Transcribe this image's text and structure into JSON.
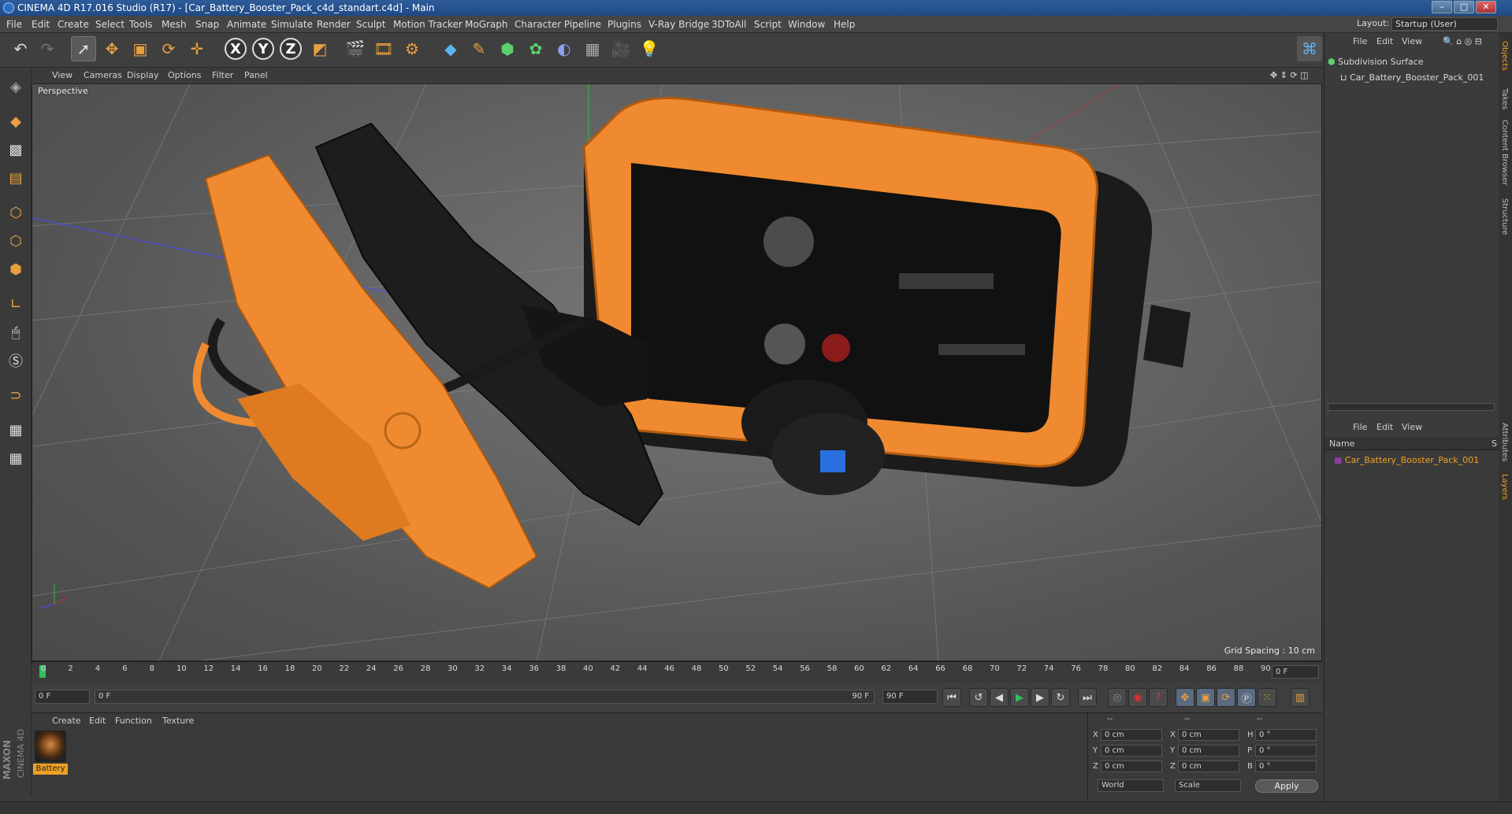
{
  "window": {
    "title": "CINEMA 4D R17.016 Studio (R17) - [Car_Battery_Booster_Pack_c4d_standart.c4d] - Main",
    "layout_label": "Layout:",
    "layout_value": "Startup (User)"
  },
  "menubar": {
    "items": [
      "File",
      "Edit",
      "Create",
      "Select",
      "Tools",
      "Mesh",
      "Snap",
      "Animate",
      "Simulate",
      "Render",
      "Sculpt",
      "Motion Tracker",
      "MoGraph",
      "Character",
      "Pipeline",
      "Plugins",
      "V-Ray Bridge",
      "3DToAll",
      "Script",
      "Window",
      "Help"
    ]
  },
  "toolbar": {
    "axis_x": "X",
    "axis_y": "Y",
    "axis_z": "Z"
  },
  "viewport": {
    "menu": [
      "View",
      "Cameras",
      "Display",
      "Options",
      "Filter",
      "Panel"
    ],
    "camera_label": "Perspective",
    "grid_spacing": "Grid Spacing : 10 cm"
  },
  "timeline": {
    "ticks": [
      "0",
      "2",
      "4",
      "6",
      "8",
      "10",
      "12",
      "14",
      "16",
      "18",
      "20",
      "22",
      "24",
      "26",
      "28",
      "30",
      "32",
      "34",
      "36",
      "38",
      "40",
      "42",
      "44",
      "46",
      "48",
      "50",
      "52",
      "54",
      "56",
      "58",
      "60",
      "62",
      "64",
      "66",
      "68",
      "70",
      "72",
      "74",
      "76",
      "78",
      "80",
      "82",
      "84",
      "86",
      "88",
      "90"
    ],
    "current_frame": "0 F"
  },
  "transport": {
    "start_field": "0 F",
    "range_start": "0 F",
    "range_end": "90 F",
    "end_field": "90 F"
  },
  "material_manager": {
    "menu": [
      "Create",
      "Edit",
      "Function",
      "Texture"
    ],
    "material_name": "Battery"
  },
  "branding": {
    "vendor": "MAXON",
    "product": "CINEMA 4D"
  },
  "coordinates": {
    "header": [
      "--",
      "--",
      "--"
    ],
    "rows": [
      {
        "a": "X",
        "av": "0 cm",
        "b": "X",
        "bv": "0 cm",
        "c": "H",
        "cv": "0 °"
      },
      {
        "a": "Y",
        "av": "0 cm",
        "b": "Y",
        "bv": "0 cm",
        "c": "P",
        "cv": "0 °"
      },
      {
        "a": "Z",
        "av": "0 cm",
        "b": "Z",
        "bv": "0 cm",
        "c": "B",
        "cv": "0 °"
      }
    ],
    "space": "World",
    "mode": "Scale",
    "apply": "Apply"
  },
  "object_manager": {
    "menu": [
      "File",
      "Edit",
      "View"
    ],
    "objects": [
      "Subdivision Surface",
      "Car_Battery_Booster_Pack_001"
    ]
  },
  "layer_manager": {
    "menu": [
      "File",
      "Edit",
      "View"
    ],
    "column_name": "Name",
    "column_s": "S",
    "layers": [
      "Car_Battery_Booster_Pack_001"
    ]
  },
  "right_tabs": [
    "Objects",
    "Takes",
    "Content Browser",
    "Structure",
    "Attributes",
    "Layers"
  ],
  "colors": {
    "accent": "#f0a020",
    "selection": "#e8a040",
    "viewport_bg": "#6a6a6a",
    "object_orange": "#f08a30"
  }
}
